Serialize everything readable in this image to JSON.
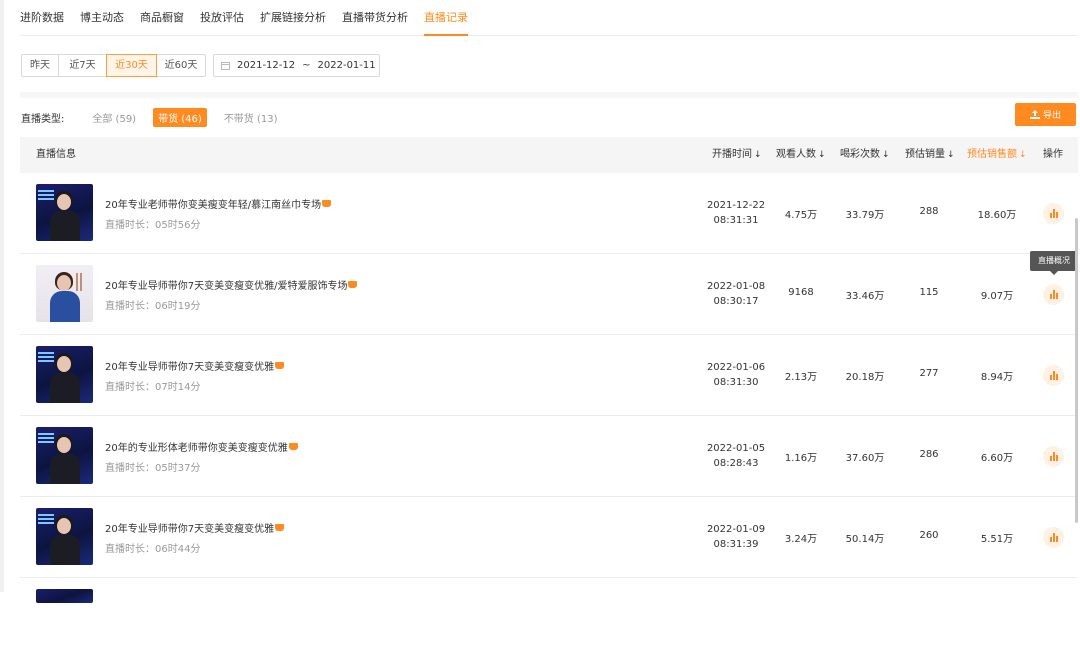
{
  "tabs": [
    "进阶数据",
    "博主动态",
    "商品橱窗",
    "投放评估",
    "扩展链接分析",
    "直播带货分析",
    "直播记录"
  ],
  "active_tab": "直播记录",
  "date_filter": {
    "ranges": [
      "昨天",
      "近7天",
      "近30天",
      "近60天"
    ],
    "active": "近30天",
    "start": "2021-12-12",
    "separator": "~",
    "end": "2022-01-11"
  },
  "live_type": {
    "label": "直播类型:",
    "options": [
      "全部 (59)",
      "带货 (46)",
      "不带货 (13)"
    ],
    "active": "带货 (46)"
  },
  "export_label": "导出",
  "table": {
    "headers": {
      "info": "直播信息",
      "start_time": "开播时间",
      "viewers": "观看人数",
      "cheers": "喝彩次数",
      "est_sales_qty": "预估销量",
      "est_sales_amount": "预估销售额",
      "action": "操作"
    },
    "sort_arrow": "↓",
    "rows": [
      {
        "title": "20年专业老师带你变美瘦变年轻/慕江南丝巾专场",
        "duration": "直播时长：05时56分",
        "date": "2021-12-22",
        "time": "08:31:31",
        "viewers": "4.75万",
        "cheers": "33.79万",
        "qty": "288",
        "amount": "18.60万"
      },
      {
        "title": "20年专业导师带你7天变美变瘦变优雅/爱特爱服饰专场",
        "duration": "直播时长：06时19分",
        "date": "2022-01-08",
        "time": "08:30:17",
        "viewers": "9168",
        "cheers": "33.46万",
        "qty": "115",
        "amount": "9.07万"
      },
      {
        "title": "20年专业导师带你7天变美变瘦变优雅",
        "duration": "直播时长：07时14分",
        "date": "2022-01-06",
        "time": "08:31:30",
        "viewers": "2.13万",
        "cheers": "20.18万",
        "qty": "277",
        "amount": "8.94万"
      },
      {
        "title": "20年的专业形体老师带你变美变瘦变优雅",
        "duration": "直播时长：05时37分",
        "date": "2022-01-05",
        "time": "08:28:43",
        "viewers": "1.16万",
        "cheers": "37.60万",
        "qty": "286",
        "amount": "6.60万"
      },
      {
        "title": "20年专业导师带你7天变美变瘦变优雅",
        "duration": "直播时长：06时44分",
        "date": "2022-01-09",
        "time": "08:31:39",
        "viewers": "3.24万",
        "cheers": "50.14万",
        "qty": "260",
        "amount": "5.51万"
      }
    ]
  },
  "tooltip": "直播概况",
  "colors": {
    "accent": "#ff8a1f"
  }
}
